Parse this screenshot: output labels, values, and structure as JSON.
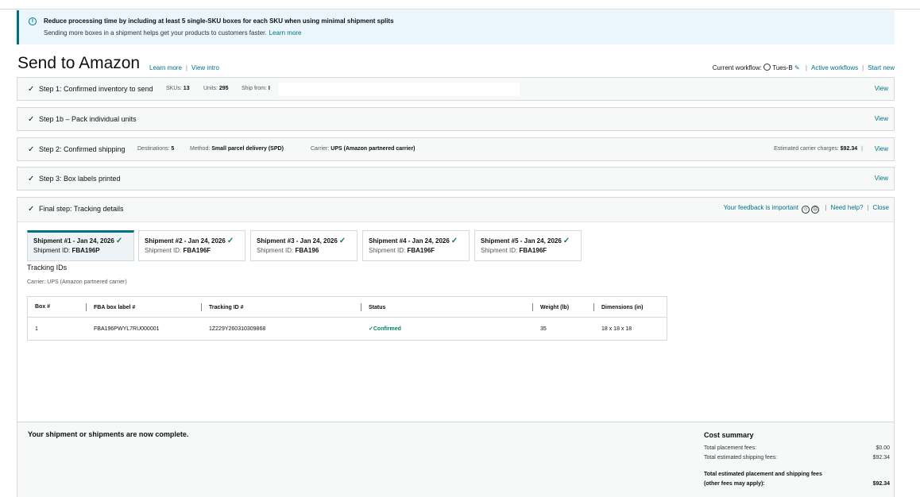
{
  "alert": {
    "title": "Reduce processing time by including at least 5 single-SKU boxes for each SKU when using minimal shipment splits",
    "body": "Sending more boxes in a shipment helps get your products to customers faster.",
    "link": "Learn more"
  },
  "header": {
    "title": "Send to Amazon",
    "learn_more": "Learn more",
    "view_intro": "View intro",
    "current_workflow_label": "Current workflow:",
    "workflow_name": "Tues-B",
    "active_workflows": "Active workflows",
    "start_new": "Start new"
  },
  "steps": {
    "step1": {
      "title": "Step 1: Confirmed inventory to send",
      "skus_label": "SKUs:",
      "skus": "13",
      "units_label": "Units:",
      "units": "295",
      "ship_from_label": "Ship from:",
      "ship_from": "I",
      "view": "View"
    },
    "step1b": {
      "title": "Step 1b – Pack individual units",
      "view": "View"
    },
    "step2": {
      "title": "Step 2: Confirmed shipping",
      "destinations_label": "Destinations:",
      "destinations": "5",
      "method_label": "Method:",
      "method": "Small parcel delivery (SPD)",
      "carrier_label": "Carrier:",
      "carrier": "UPS (Amazon partnered carrier)",
      "charges_label": "Estimated carrier charges:",
      "charges": "$92.34",
      "view": "View"
    },
    "step3": {
      "title": "Step 3: Box labels printed",
      "view": "View"
    }
  },
  "final": {
    "title": "Final step: Tracking details",
    "feedback": "Your feedback is important",
    "need_help": "Need help?",
    "close": "Close",
    "tabs": [
      {
        "title": "Shipment #1 - Jan 24, 2026",
        "id_label": "Shipment ID:",
        "id": "FBA196P"
      },
      {
        "title": "Shipment #2 - Jan 24, 2026",
        "id_label": "Shipment ID:",
        "id": "FBA196F"
      },
      {
        "title": "Shipment #3 - Jan 24, 2026",
        "id_label": "Shipment ID:",
        "id": "FBA196"
      },
      {
        "title": "Shipment #4 - Jan 24, 2026",
        "id_label": "Shipment ID:",
        "id": "FBA196F"
      },
      {
        "title": "Shipment #5 - Jan 24, 2026",
        "id_label": "Shipment ID:",
        "id": "FBA196F"
      }
    ],
    "tracking_title": "Tracking IDs",
    "carrier": "Carrier: UPS (Amazon partnered carrier)",
    "columns": [
      "Box #",
      "FBA box label #",
      "Tracking ID #",
      "Status",
      "Weight (lb)",
      "Dimensions (in)"
    ],
    "rows": [
      {
        "box": "1",
        "label": "FBA196PWYL7RU000001",
        "tracking": "1Z229Y260310309868",
        "status": "Confirmed",
        "weight": "35",
        "dimensions": "18 x 18 x 18"
      }
    ]
  },
  "summary": {
    "complete": "Your shipment or shipments are now complete.",
    "cost_title": "Cost summary",
    "placement_label": "Total placement fees:",
    "placement": "$0.00",
    "shipping_label": "Total estimated shipping fees:",
    "shipping": "$92.34",
    "total_label_1": "Total estimated placement and shipping fees",
    "total_label_2": "(other fees may apply):",
    "total": "$92.34"
  }
}
